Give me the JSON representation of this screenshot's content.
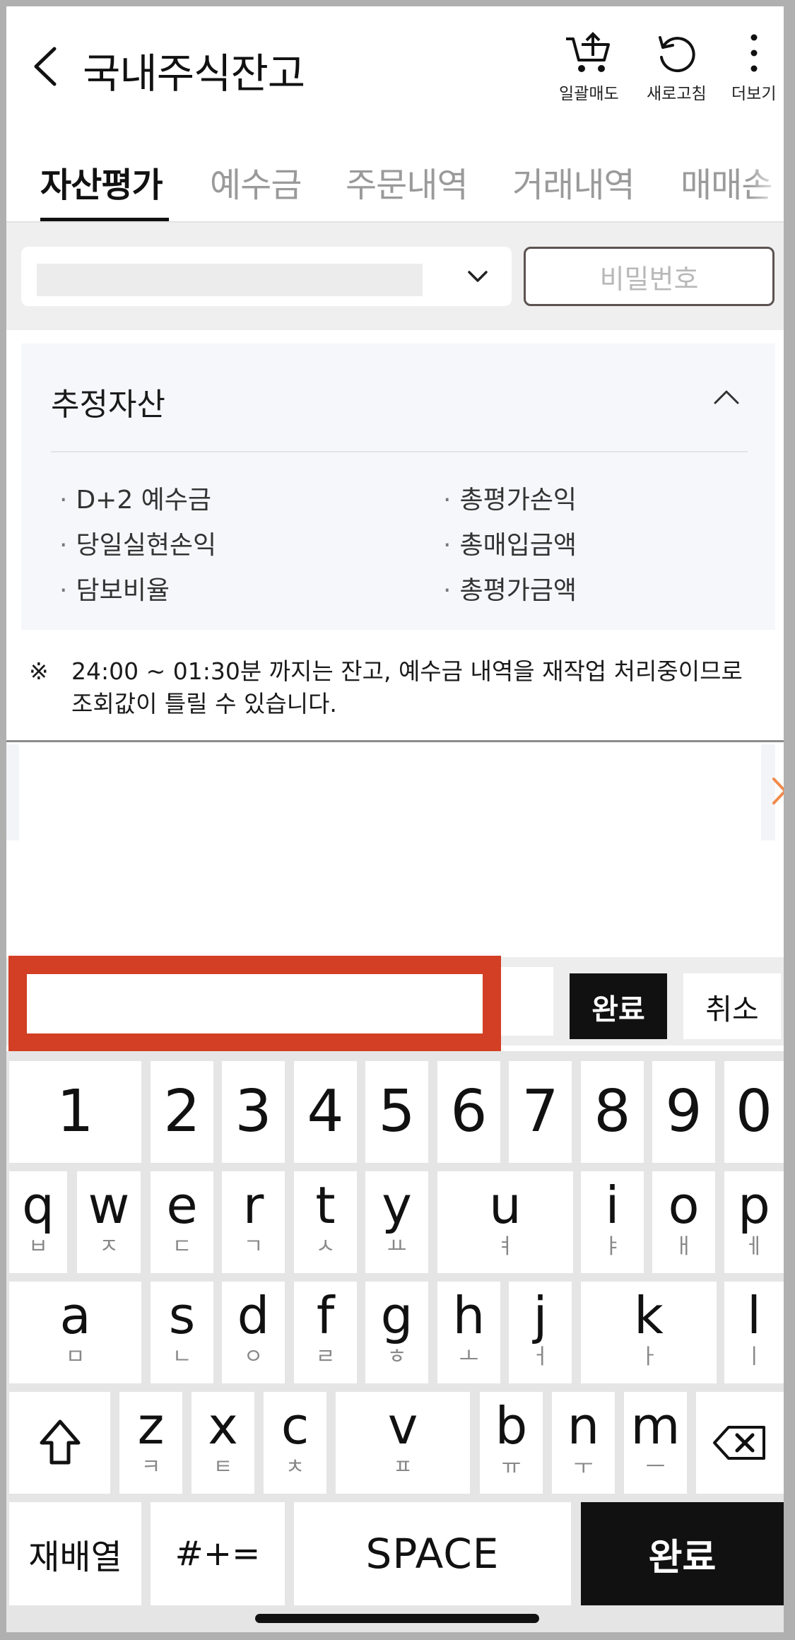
{
  "header": {
    "title": "국내주식잔고",
    "actions": [
      {
        "label": "일괄매도",
        "icon": "cart-upload-icon"
      },
      {
        "label": "새로고침",
        "icon": "refresh-icon"
      },
      {
        "label": "더보기",
        "icon": "more-vertical-icon"
      }
    ]
  },
  "tabs": [
    {
      "label": "자산평가",
      "active": true
    },
    {
      "label": "예수금",
      "active": false
    },
    {
      "label": "주문내역",
      "active": false
    },
    {
      "label": "거래내역",
      "active": false
    },
    {
      "label": "매매손",
      "active": false
    }
  ],
  "account": {
    "password_label": "비밀번호"
  },
  "assets": {
    "title": "추정자산",
    "left_items": [
      "D+2 예수금",
      "당일실현손익",
      "담보비율"
    ],
    "right_items": [
      "총평가손익",
      "총매입금액",
      "총평가금액"
    ]
  },
  "notice": {
    "mark": "※",
    "text": "24:00 ~ 01:30분 까지는 잔고, 예수금 내역을 재작업 처리중이므로 조회값이 틀릴 수 있습니다."
  },
  "keypad_bar": {
    "done_label": "완료",
    "cancel_label": "취소"
  },
  "keyboard": {
    "numbers": [
      "1",
      "2",
      "3",
      "4",
      "5",
      "6",
      "7",
      "8",
      "9",
      "0"
    ],
    "row1": [
      {
        "main": "q",
        "sub": "ㅂ"
      },
      {
        "main": "w",
        "sub": "ㅈ"
      },
      {
        "main": "e",
        "sub": "ㄷ"
      },
      {
        "main": "r",
        "sub": "ㄱ"
      },
      {
        "main": "t",
        "sub": "ㅅ"
      },
      {
        "main": "y",
        "sub": "ㅛ"
      },
      {
        "main": "u",
        "sub": "ㅕ"
      },
      {
        "main": "i",
        "sub": "ㅑ"
      },
      {
        "main": "o",
        "sub": "ㅐ"
      },
      {
        "main": "p",
        "sub": "ㅔ"
      }
    ],
    "row2": [
      {
        "main": "a",
        "sub": "ㅁ"
      },
      {
        "main": "s",
        "sub": "ㄴ"
      },
      {
        "main": "d",
        "sub": "ㅇ"
      },
      {
        "main": "f",
        "sub": "ㄹ"
      },
      {
        "main": "g",
        "sub": "ㅎ"
      },
      {
        "main": "h",
        "sub": "ㅗ"
      },
      {
        "main": "j",
        "sub": "ㅓ"
      },
      {
        "main": "k",
        "sub": "ㅏ"
      },
      {
        "main": "l",
        "sub": "ㅣ"
      }
    ],
    "row3": [
      {
        "main": "z",
        "sub": "ㅋ"
      },
      {
        "main": "x",
        "sub": "ㅌ"
      },
      {
        "main": "c",
        "sub": "ㅊ"
      },
      {
        "main": "v",
        "sub": "ㅍ"
      },
      {
        "main": "b",
        "sub": "ㅠ"
      },
      {
        "main": "n",
        "sub": "ㅜ"
      },
      {
        "main": "m",
        "sub": "ㅡ"
      }
    ],
    "bottom": {
      "rearrange": "재배열",
      "symbols": "#+=",
      "space": "SPACE",
      "done": "완료"
    }
  },
  "colors": {
    "highlight": "#d23f24",
    "accent_arrow": "#f08a4b",
    "dark": "#111111"
  }
}
